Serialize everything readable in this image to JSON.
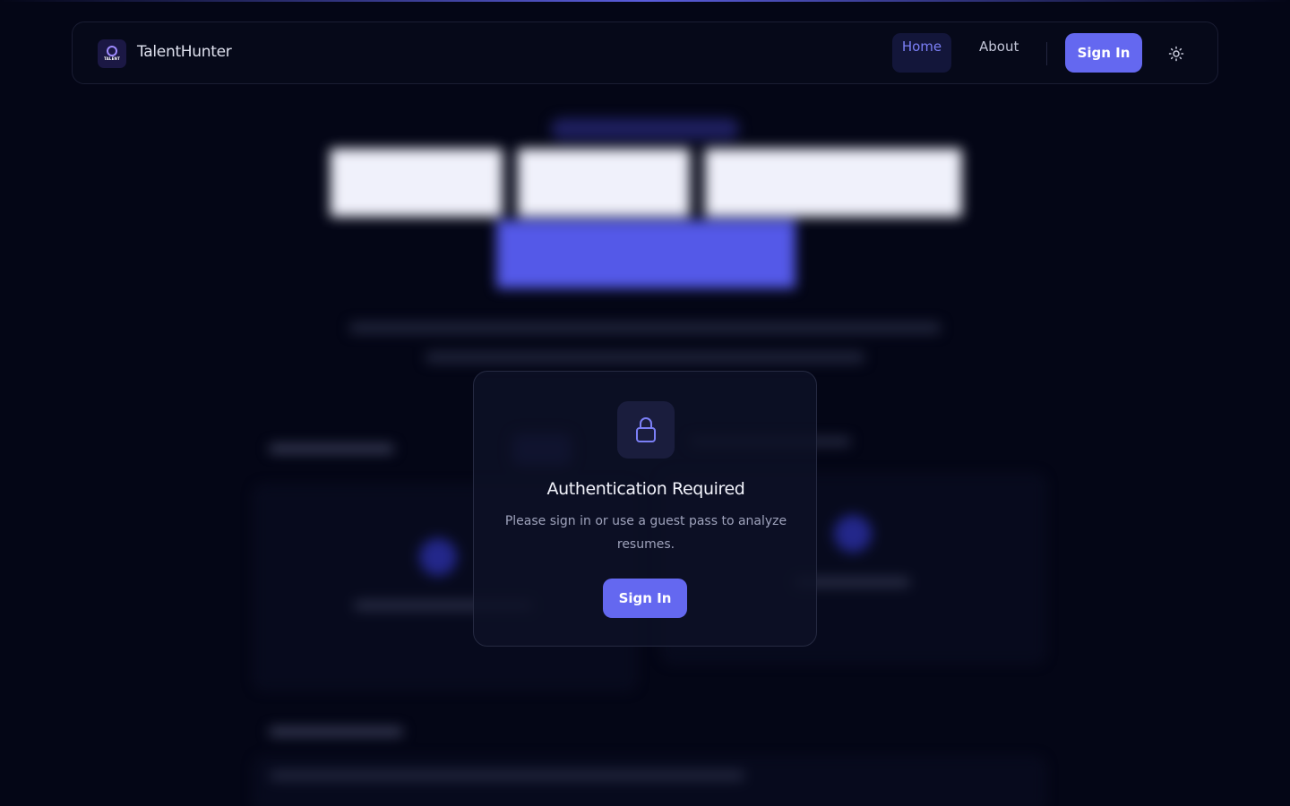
{
  "navbar": {
    "logo_text": "TALENT",
    "brand": "TalentHunter",
    "home_label": "Home",
    "about_label": "About",
    "signin_label": "Sign In",
    "theme_icon": "sun-icon"
  },
  "modal": {
    "icon": "lock-icon",
    "title": "Authentication Required",
    "message": "Please sign in or use a guest pass to analyze resumes.",
    "signin_label": "Sign In"
  },
  "colors": {
    "background": "#040616",
    "accent": "#6468f0",
    "accent_text": "#7b7ff6"
  }
}
